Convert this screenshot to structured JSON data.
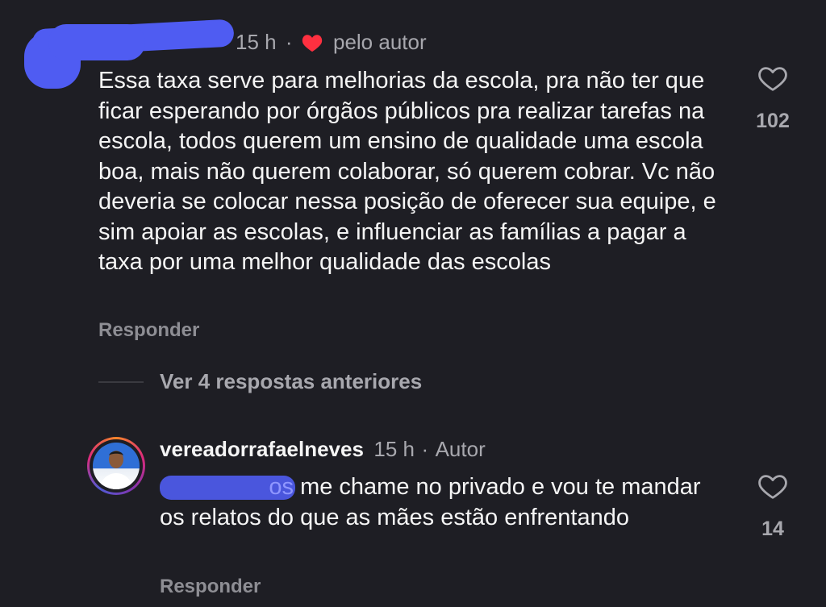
{
  "comment1": {
    "time": "15 h",
    "separator": "·",
    "liked_by_author": "pelo autor",
    "text": "Essa taxa serve para melhorias da escola, pra não ter que ficar esperando por órgãos públicos pra realizar tarefas na escola, todos querem um ensino de qualidade uma escola boa, mais não querem colaborar, só querem cobrar. Vc não deveria se colocar nessa posição de oferecer sua equipe, e sim apoiar as escolas, e influenciar as famílias a pagar a taxa por uma melhor qualidade das escolas",
    "reply_label": "Responder",
    "like_count": "102",
    "heart_icon": "heart-outline-icon",
    "liked_icon": "heart-filled-icon"
  },
  "view_replies": {
    "label": "Ver 4 respostas anteriores"
  },
  "comment2": {
    "username": "vereadorrafaelneves",
    "time": "15 h",
    "separator": "·",
    "badge": "Autor",
    "mention_visible_tail": "os",
    "text": "me chame no privado e vou te mandar os relatos do que as mães estão enfrentando",
    "reply_label": "Responder",
    "like_count": "14",
    "heart_icon": "heart-outline-icon"
  },
  "colors": {
    "background": "#1e1e24",
    "text": "#f5f5f5",
    "muted": "#a8a8ae",
    "mention": "#8f96ff",
    "liked_heart": "#ff3040",
    "redaction": "#4f5cf2"
  }
}
